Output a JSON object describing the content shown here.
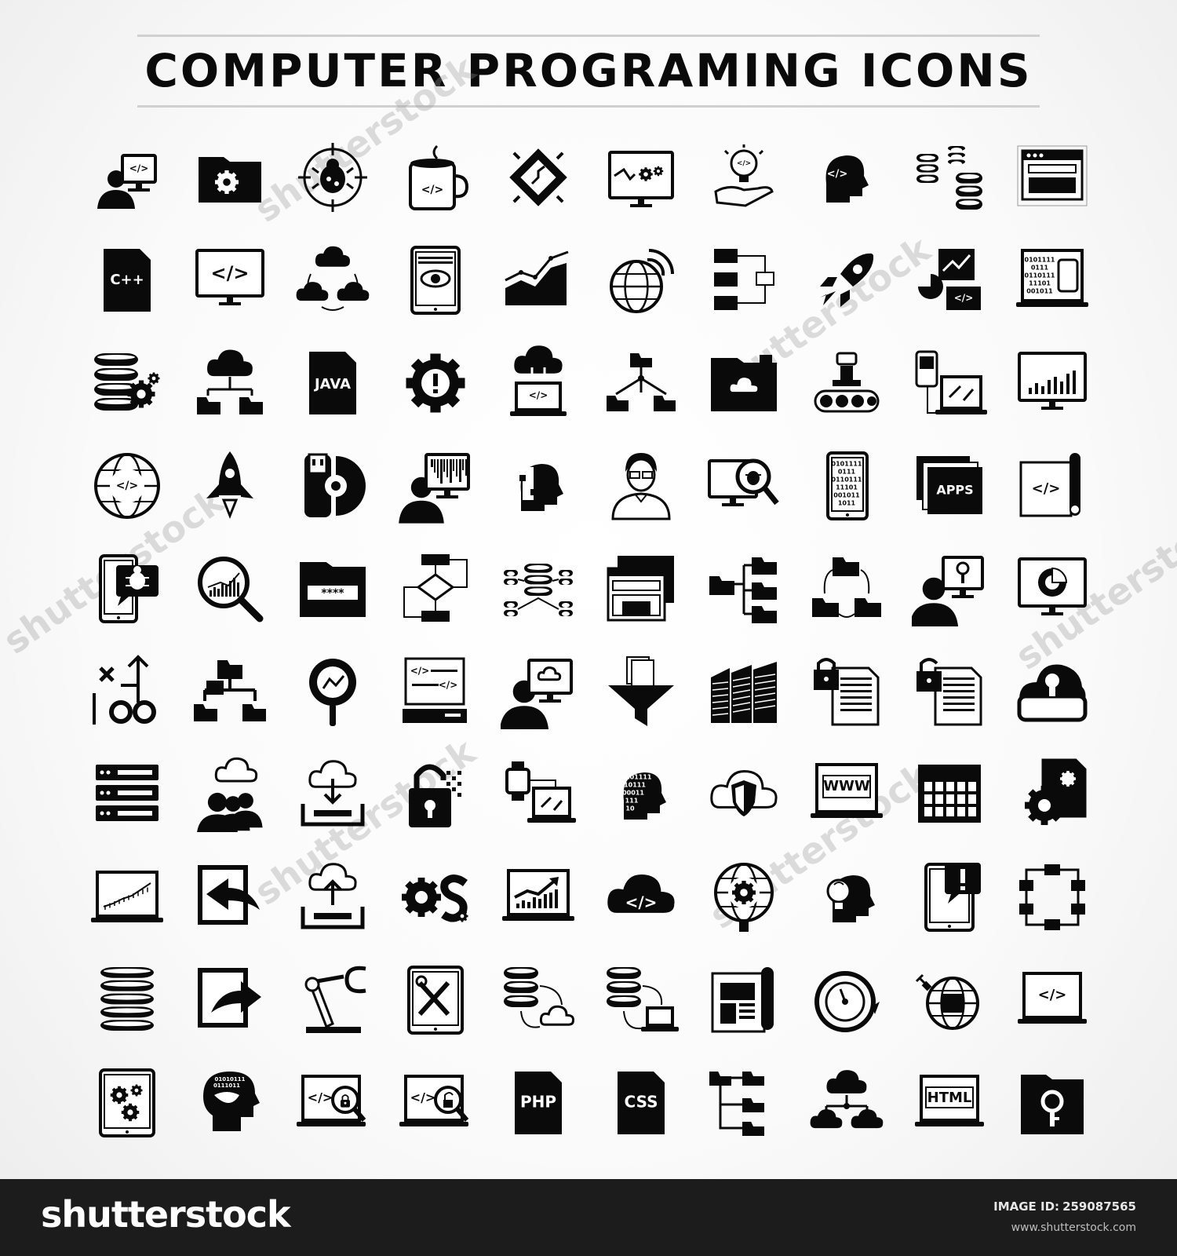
{
  "title": "COMPUTER PROGRAMING ICONS",
  "watermark": "shutterstock",
  "footer": {
    "logo": "shutterstock",
    "image_id_label": "IMAGE ID:",
    "image_id": "259087565",
    "site": "www.shutterstock.com"
  },
  "icon_labels": {
    "cpp": "C++",
    "java": "JAVA",
    "apps": "APPS",
    "www": "WWW",
    "php": "PHP",
    "css": "CSS",
    "html": "HTML",
    "password": "****",
    "code": "</>"
  },
  "icons": [
    "developer-monitor-icon",
    "gear-folder-icon",
    "bug-target-icon",
    "code-mug-icon",
    "chip-icon",
    "monitor-gears-icon",
    "idea-hand-icon",
    "head-code-icon",
    "database-network-icon",
    "browser-window-icon",
    "cpp-file-icon",
    "code-monitor-icon",
    "cloud-network-icon",
    "tablet-eye-icon",
    "area-chart-icon",
    "globe-signal-icon",
    "flowchart-icon",
    "rocket-icon",
    "chart-devices-icon",
    "binary-laptop-icon",
    "database-gear-icon",
    "cloud-folders-icon",
    "java-file-icon",
    "gear-alert-icon",
    "cloud-laptop-icon",
    "folder-network-icon",
    "cloud-folder-icon",
    "robot-conveyor-icon",
    "mobile-laptop-icon",
    "bar-chart-monitor-icon",
    "code-globe-icon",
    "rocket-launch-icon",
    "usb-disk-icon",
    "user-barcode-icon",
    "head-puzzle-icon",
    "programmer-avatar-icon",
    "bug-search-monitor-icon",
    "binary-tablet-icon",
    "apps-windows-icon",
    "code-scroll-icon",
    "bug-tablet-icon",
    "search-chart-icon",
    "password-folder-icon",
    "flowchart-diamond-icon",
    "database-hub-icon",
    "browser-windows-icon",
    "folder-tree-icon",
    "folder-cycle-icon",
    "user-key-monitor-icon",
    "pie-chart-monitor-icon",
    "strategy-icon",
    "folder-hierarchy-icon",
    "search-analytics-icon",
    "code-server-icon",
    "user-cloud-monitor-icon",
    "filter-files-icon",
    "buildings-icon",
    "lock-document-icon",
    "unlock-document-icon",
    "cloud-keyhole-icon",
    "server-rack-icon",
    "cloud-users-icon",
    "cloud-download-icon",
    "padlock-pixel-icon",
    "watch-laptop-icon",
    "binary-head-icon",
    "cloud-shield-icon",
    "www-laptop-icon",
    "calendar-grid-icon",
    "gear-document-icon",
    "laptop-graph-icon",
    "import-arrow-icon",
    "cloud-upload-icon",
    "os-gears-icon",
    "laptop-growth-icon",
    "cloud-code-icon",
    "globe-gear-icon",
    "head-bulb-icon",
    "tablet-alert-icon",
    "network-ring-icon",
    "database-stack-icon",
    "export-arrow-icon",
    "robot-arm-icon",
    "tablet-tools-icon",
    "database-cloud-icon",
    "database-laptop-icon",
    "blueprint-icon",
    "speedometer-icon",
    "globe-plug-icon",
    "code-laptop-icon",
    "tablet-gears-icon",
    "binary-brain-icon",
    "laptop-lock-search-icon",
    "laptop-unlock-search-icon",
    "php-file-icon",
    "css-file-icon",
    "folder-branch-icon",
    "cloud-tree-icon",
    "html-laptop-icon",
    "key-folder-icon"
  ]
}
